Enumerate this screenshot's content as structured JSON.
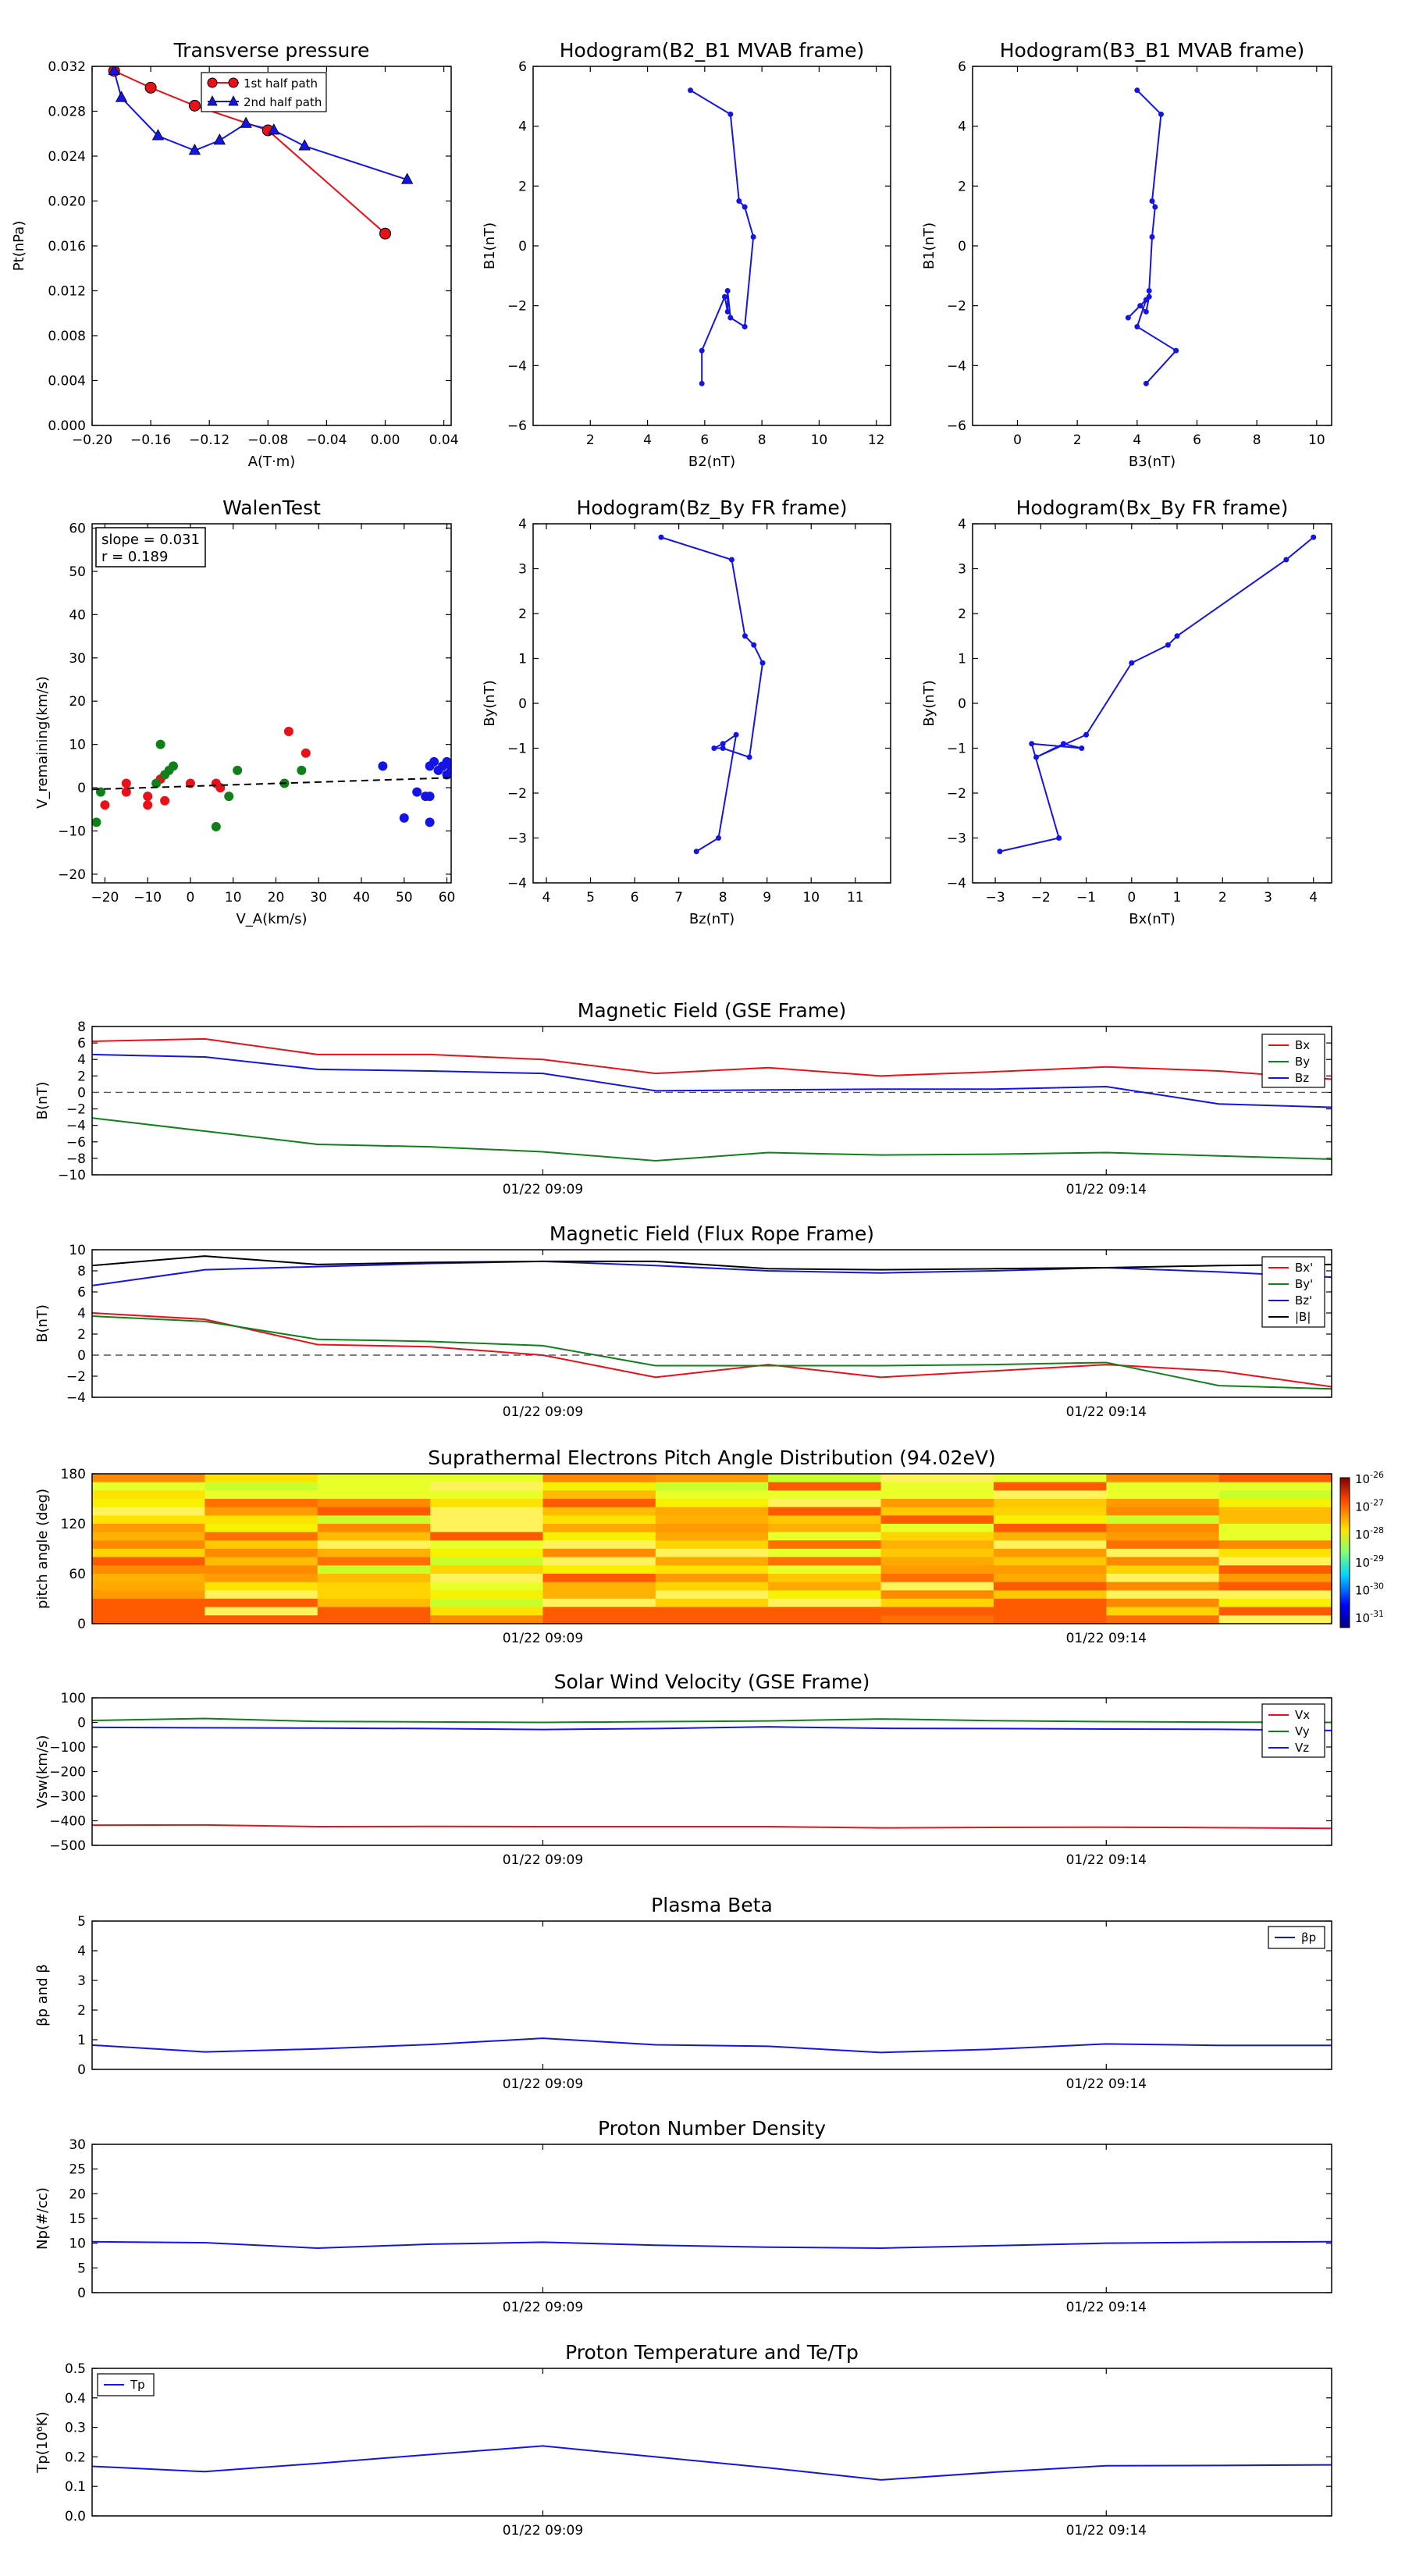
{
  "colors": {
    "red": "#e8111a",
    "green": "#11801a",
    "blue": "#1414e6",
    "black": "#000000"
  },
  "scatter_panels": [
    {
      "key": "tp",
      "title": "Transverse pressure",
      "xlabel": "A(T·m)",
      "ylabel": "Pt(nPa)",
      "xlim": [
        -0.2,
        0.045
      ],
      "ylim": [
        0,
        0.032
      ],
      "xticks": [
        -0.2,
        -0.16,
        -0.12,
        -0.08,
        -0.04,
        0.0,
        0.04
      ],
      "xtick_labels": [
        "−0.20",
        "−0.16",
        "−0.12",
        "−0.08",
        "−0.04",
        "0.00",
        "0.04"
      ],
      "yticks": [
        0,
        0.004,
        0.008,
        0.012,
        0.016,
        0.02,
        0.024,
        0.028,
        0.032
      ],
      "ytick_labels": [
        "0.000",
        "0.004",
        "0.008",
        "0.012",
        "0.016",
        "0.020",
        "0.024",
        "0.028",
        "0.032"
      ],
      "legend": [
        "1st half path",
        "2nd half path"
      ]
    },
    {
      "key": "h1",
      "title": "Hodogram(B2_B1 MVAB frame)",
      "xlabel": "B2(nT)",
      "ylabel": "B1(nT)",
      "xlim": [
        0,
        12.5
      ],
      "ylim": [
        -6,
        6
      ],
      "xticks": [
        2,
        4,
        6,
        8,
        10,
        12
      ],
      "xtick_labels": [
        "2",
        "4",
        "6",
        "8",
        "10",
        "12"
      ],
      "yticks": [
        -6,
        -4,
        -2,
        0,
        2,
        4,
        6
      ],
      "ytick_labels": [
        "−6",
        "−4",
        "−2",
        "0",
        "2",
        "4",
        "6"
      ]
    },
    {
      "key": "h2",
      "title": "Hodogram(B3_B1 MVAB frame)",
      "xlabel": "B3(nT)",
      "ylabel": "B1(nT)",
      "xlim": [
        -1.5,
        10.5
      ],
      "ylim": [
        -6,
        6
      ],
      "xticks": [
        0,
        2,
        4,
        6,
        8,
        10
      ],
      "xtick_labels": [
        "0",
        "2",
        "4",
        "6",
        "8",
        "10"
      ],
      "yticks": [
        -6,
        -4,
        -2,
        0,
        2,
        4,
        6
      ],
      "ytick_labels": [
        "−6",
        "−4",
        "−2",
        "0",
        "2",
        "4",
        "6"
      ]
    },
    {
      "key": "wt",
      "title": "WalenTest",
      "xlabel": "V_A(km/s)",
      "ylabel": "V_remaining(km/s)",
      "xlim": [
        -23,
        61
      ],
      "ylim": [
        -22,
        61
      ],
      "xticks": [
        -20,
        -10,
        0,
        10,
        20,
        30,
        40,
        50,
        60
      ],
      "xtick_labels": [
        "−20",
        "−10",
        "0",
        "10",
        "20",
        "30",
        "40",
        "50",
        "60"
      ],
      "yticks": [
        -20,
        -10,
        0,
        10,
        20,
        30,
        40,
        50,
        60
      ],
      "ytick_labels": [
        "−20",
        "−10",
        "0",
        "10",
        "20",
        "30",
        "40",
        "50",
        "60"
      ],
      "annotation": [
        "slope = 0.031",
        "r = 0.189"
      ]
    },
    {
      "key": "h3",
      "title": "Hodogram(Bz_By FR frame)",
      "xlabel": "Bz(nT)",
      "ylabel": "By(nT)",
      "xlim": [
        3.7,
        11.8
      ],
      "ylim": [
        -4,
        4
      ],
      "xticks": [
        4,
        5,
        6,
        7,
        8,
        9,
        10,
        11
      ],
      "xtick_labels": [
        "4",
        "5",
        "6",
        "7",
        "8",
        "9",
        "10",
        "11"
      ],
      "yticks": [
        -4,
        -3,
        -2,
        -1,
        0,
        1,
        2,
        3,
        4
      ],
      "ytick_labels": [
        "−4",
        "−3",
        "−2",
        "−1",
        "0",
        "1",
        "2",
        "3",
        "4"
      ]
    },
    {
      "key": "h4",
      "title": "Hodogram(Bx_By FR frame)",
      "xlabel": "Bx(nT)",
      "ylabel": "By(nT)",
      "xlim": [
        -3.5,
        4.4
      ],
      "ylim": [
        -4,
        4
      ],
      "xticks": [
        -3,
        -2,
        -1,
        0,
        1,
        2,
        3,
        4
      ],
      "xtick_labels": [
        "−3",
        "−2",
        "−1",
        "0",
        "1",
        "2",
        "3",
        "4"
      ],
      "yticks": [
        -4,
        -3,
        -2,
        -1,
        0,
        1,
        2,
        3,
        4
      ],
      "ytick_labels": [
        "−4",
        "−3",
        "−2",
        "−1",
        "0",
        "1",
        "2",
        "3",
        "4"
      ]
    }
  ],
  "time_axis": {
    "tick_labels": [
      "01/22 09:09",
      "01/22 09:14"
    ],
    "tick_positions": [
      4,
      9
    ],
    "xlim": [
      0,
      11
    ]
  },
  "ts_panels": [
    {
      "key": "mag_gse",
      "title": "Magnetic Field (GSE Frame)",
      "ylabel": "B(nT)",
      "ylim": [
        -10,
        8
      ],
      "yticks": [
        -10,
        -8,
        -6,
        -4,
        -2,
        0,
        2,
        4,
        6,
        8
      ],
      "ytick_labels": [
        "−10",
        "−8",
        "−6",
        "−4",
        "−2",
        "0",
        "2",
        "4",
        "6",
        "8"
      ],
      "zero_line": true,
      "legend": [
        "Bx",
        "By",
        "Bz"
      ]
    },
    {
      "key": "mag_fr",
      "title": "Magnetic Field (Flux Rope Frame)",
      "ylabel": "B(nT)",
      "ylim": [
        -4,
        10
      ],
      "yticks": [
        -4,
        -2,
        0,
        2,
        4,
        6,
        8,
        10
      ],
      "ytick_labels": [
        "−4",
        "−2",
        "0",
        "2",
        "4",
        "6",
        "8",
        "10"
      ],
      "zero_line": true,
      "legend": [
        "Bx'",
        "By'",
        "Bz'",
        "|B|"
      ]
    },
    {
      "key": "pad",
      "title": "Suprathermal Electrons Pitch Angle Distribution (94.02eV)",
      "ylabel": "pitch angle (deg)",
      "ylim": [
        0,
        180
      ],
      "yticks": [
        0,
        60,
        120,
        180
      ],
      "ytick_labels": [
        "0",
        "60",
        "120",
        "180"
      ],
      "colorbar_labels": [
        "10",
        "10",
        "10",
        "10",
        "10",
        "10"
      ],
      "colorbar_exponents": [
        "-26",
        "-27",
        "-28",
        "-29",
        "-30",
        "-31"
      ]
    },
    {
      "key": "vsw",
      "title": "Solar Wind Velocity (GSE Frame)",
      "ylabel": "Vsw(km/s)",
      "ylim": [
        -500,
        100
      ],
      "yticks": [
        -500,
        -400,
        -300,
        -200,
        -100,
        0,
        100
      ],
      "ytick_labels": [
        "−500",
        "−400",
        "−300",
        "−200",
        "−100",
        "0",
        "100"
      ],
      "legend": [
        "Vx",
        "Vy",
        "Vz"
      ]
    },
    {
      "key": "beta",
      "title": "Plasma Beta",
      "ylabel": "βp and β",
      "ylim": [
        0,
        5
      ],
      "yticks": [
        0,
        1,
        2,
        3,
        4,
        5
      ],
      "ytick_labels": [
        "0",
        "1",
        "2",
        "3",
        "4",
        "5"
      ],
      "legend": [
        "βp"
      ]
    },
    {
      "key": "np",
      "title": "Proton Number Density",
      "ylabel": "Np(#/cc)",
      "ylim": [
        0,
        30
      ],
      "yticks": [
        0,
        5,
        10,
        15,
        20,
        25,
        30
      ],
      "ytick_labels": [
        "0",
        "5",
        "10",
        "15",
        "20",
        "25",
        "30"
      ]
    },
    {
      "key": "tp_ts",
      "title": "Proton Temperature and Te/Tp",
      "ylabel": "Tp(10⁶K)",
      "ylim": [
        0,
        0.5
      ],
      "yticks": [
        0,
        0.1,
        0.2,
        0.3,
        0.4,
        0.5
      ],
      "ytick_labels": [
        "0.0",
        "0.1",
        "0.2",
        "0.3",
        "0.4",
        "0.5"
      ],
      "legend": [
        "Tp"
      ]
    }
  ],
  "chart_data": [
    {
      "type": "line",
      "title": "Transverse pressure",
      "xlabel": "A(T·m)",
      "ylabel": "Pt(nPa)",
      "series": [
        {
          "name": "1st half path",
          "x": [
            -0.185,
            -0.16,
            -0.13,
            -0.08,
            0.0
          ],
          "y": [
            0.0316,
            0.0301,
            0.0285,
            0.0263,
            0.0171
          ]
        },
        {
          "name": "2nd half path",
          "x": [
            -0.185,
            -0.18,
            -0.155,
            -0.13,
            -0.113,
            -0.095,
            -0.076,
            -0.055,
            0.015
          ],
          "y": [
            0.0316,
            0.0292,
            0.0258,
            0.0245,
            0.0254,
            0.0269,
            0.0263,
            0.0249,
            0.0219
          ]
        }
      ]
    },
    {
      "type": "line",
      "title": "Hodogram(B2_B1 MVAB frame)",
      "xlabel": "B2(nT)",
      "ylabel": "B1(nT)",
      "series": [
        {
          "x": [
            5.5,
            6.9,
            7.2,
            7.4,
            7.7,
            7.4,
            6.9,
            6.8,
            6.8,
            6.7,
            5.9,
            5.9
          ],
          "y": [
            5.2,
            4.4,
            1.5,
            1.3,
            0.3,
            -2.7,
            -2.4,
            -1.5,
            -2.2,
            -1.7,
            -3.5,
            -4.6
          ]
        }
      ]
    },
    {
      "type": "line",
      "title": "Hodogram(B3_B1 MVAB frame)",
      "xlabel": "B3(nT)",
      "ylabel": "B1(nT)",
      "series": [
        {
          "x": [
            4.0,
            4.8,
            4.5,
            4.6,
            4.5,
            4.4,
            4.4,
            4.3,
            4.1,
            3.7,
            4.3,
            4.0,
            5.3,
            4.3
          ],
          "y": [
            5.2,
            4.4,
            1.5,
            1.3,
            0.3,
            -1.5,
            -1.7,
            -2.2,
            -2.0,
            -2.4,
            -1.8,
            -2.7,
            -3.5,
            -4.6
          ]
        }
      ]
    },
    {
      "type": "scatter",
      "title": "WalenTest",
      "xlabel": "V_A(km/s)",
      "ylabel": "V_remaining(km/s)",
      "annotation": [
        "slope = 0.031",
        "r = 0.189"
      ],
      "series": [
        {
          "x": [
            -20,
            -15,
            -15,
            -10,
            -10,
            -7,
            -6,
            0,
            6,
            7,
            23,
            27
          ],
          "y": [
            -4,
            -1,
            1,
            -2,
            -4,
            2,
            -3,
            1,
            1,
            0,
            13,
            8
          ]
        },
        {
          "x": [
            -22,
            -21,
            -8,
            -7,
            -6,
            -5,
            -4,
            6,
            9,
            11,
            22,
            26
          ],
          "y": [
            -8,
            -1,
            1,
            10,
            3,
            4,
            5,
            -9,
            -2,
            4,
            1,
            4
          ]
        },
        {
          "x": [
            45,
            50,
            53,
            55,
            56,
            56,
            56,
            57,
            58,
            59,
            60,
            61,
            61,
            60
          ],
          "y": [
            5,
            -7,
            -1,
            -2,
            -8,
            -2,
            5,
            6,
            4,
            5,
            3,
            4,
            5,
            6
          ]
        }
      ],
      "fit": {
        "x": [
          -23,
          61
        ],
        "y": [
          -0.4,
          2.3
        ]
      }
    },
    {
      "type": "line",
      "title": "Hodogram(Bz_By FR frame)",
      "xlabel": "Bz(nT)",
      "ylabel": "By(nT)",
      "series": [
        {
          "x": [
            6.6,
            8.2,
            8.5,
            8.7,
            8.9,
            8.6,
            8.0,
            7.8,
            8.0,
            8.3,
            7.9,
            7.4
          ],
          "y": [
            3.7,
            3.2,
            1.5,
            1.3,
            0.9,
            -1.2,
            -1.0,
            -1.0,
            -0.9,
            -0.7,
            -3.0,
            -3.3
          ]
        }
      ]
    },
    {
      "type": "line",
      "title": "Hodogram(Bx_By FR frame)",
      "xlabel": "Bx(nT)",
      "ylabel": "By(nT)",
      "series": [
        {
          "x": [
            4.0,
            3.4,
            1.0,
            0.8,
            0.0,
            -1.0,
            -2.1,
            -1.5,
            -1.1,
            -2.2,
            -1.6,
            -2.9
          ],
          "y": [
            3.7,
            3.2,
            1.5,
            1.3,
            0.9,
            -0.7,
            -1.2,
            -0.9,
            -1.0,
            -0.9,
            -3.0,
            -3.3
          ]
        }
      ]
    },
    {
      "type": "line",
      "title": "Magnetic Field (GSE Frame)",
      "ylabel": "B(nT)",
      "x": [
        0,
        1,
        2,
        3,
        4,
        5,
        6,
        7,
        8,
        9,
        10,
        11
      ],
      "series": [
        {
          "name": "Bx",
          "values": [
            6.2,
            6.5,
            4.6,
            4.6,
            4.0,
            2.3,
            3.0,
            2.0,
            2.5,
            3.1,
            2.6,
            1.6
          ]
        },
        {
          "name": "By",
          "values": [
            -3.1,
            -4.7,
            -6.3,
            -6.6,
            -7.2,
            -8.3,
            -7.3,
            -7.6,
            -7.5,
            -7.3,
            -7.7,
            -8.1
          ]
        },
        {
          "name": "Bz",
          "values": [
            4.6,
            4.3,
            2.8,
            2.6,
            2.3,
            0.2,
            0.3,
            0.4,
            0.4,
            0.7,
            -1.4,
            -1.8
          ]
        }
      ]
    },
    {
      "type": "line",
      "title": "Magnetic Field (Flux Rope Frame)",
      "ylabel": "B(nT)",
      "x": [
        0,
        1,
        2,
        3,
        4,
        5,
        6,
        7,
        8,
        9,
        10,
        11
      ],
      "series": [
        {
          "name": "Bx'",
          "values": [
            4.0,
            3.4,
            1.0,
            0.8,
            0.0,
            -2.1,
            -0.9,
            -2.1,
            -1.5,
            -0.9,
            -1.5,
            -3.0
          ]
        },
        {
          "name": "By'",
          "values": [
            3.7,
            3.2,
            1.5,
            1.3,
            0.9,
            -1.0,
            -1.0,
            -1.0,
            -0.9,
            -0.7,
            -2.9,
            -3.2
          ]
        },
        {
          "name": "Bz'",
          "values": [
            6.6,
            8.1,
            8.4,
            8.7,
            8.9,
            8.5,
            8.0,
            7.8,
            8.0,
            8.3,
            7.9,
            7.4
          ]
        },
        {
          "name": "|B|",
          "values": [
            8.5,
            9.4,
            8.6,
            8.8,
            8.9,
            8.9,
            8.2,
            8.1,
            8.2,
            8.3,
            8.5,
            8.6
          ]
        }
      ]
    },
    {
      "type": "heatmap",
      "title": "Suprathermal Electrons Pitch Angle Distribution (94.02eV)",
      "ylabel": "pitch angle (deg)",
      "x_bins": 11,
      "y_bins": 18,
      "colorbar": [
        "1e-31",
        "1e-26"
      ]
    },
    {
      "type": "line",
      "title": "Solar Wind Velocity (GSE Frame)",
      "ylabel": "Vsw(km/s)",
      "x": [
        0,
        1,
        2,
        3,
        4,
        5,
        6,
        7,
        8,
        9,
        10,
        11
      ],
      "series": [
        {
          "name": "Vx",
          "values": [
            -418,
            -417,
            -424,
            -423,
            -424,
            -424,
            -424,
            -429,
            -427,
            -426,
            -428,
            -431
          ]
        },
        {
          "name": "Vy",
          "values": [
            8,
            16,
            4,
            2,
            0,
            3,
            6,
            14,
            7,
            3,
            1,
            0
          ]
        },
        {
          "name": "Vz",
          "values": [
            -20,
            -22,
            -23,
            -25,
            -29,
            -25,
            -18,
            -24,
            -25,
            -27,
            -28,
            -33
          ]
        }
      ]
    },
    {
      "type": "line",
      "title": "Plasma Beta",
      "ylabel": "βp and β",
      "x": [
        0,
        1,
        2,
        3,
        4,
        5,
        6,
        7,
        8,
        9,
        10,
        11
      ],
      "series": [
        {
          "name": "βp",
          "values": [
            0.82,
            0.59,
            0.69,
            0.84,
            1.05,
            0.83,
            0.78,
            0.57,
            0.68,
            0.86,
            0.81,
            0.81
          ]
        }
      ]
    },
    {
      "type": "line",
      "title": "Proton Number Density",
      "ylabel": "Np(#/cc)",
      "x": [
        0,
        1,
        2,
        3,
        4,
        5,
        6,
        7,
        8,
        9,
        10,
        11
      ],
      "series": [
        {
          "values": [
            10.3,
            10.1,
            9.0,
            9.8,
            10.2,
            9.6,
            9.2,
            9.0,
            9.5,
            10.0,
            10.2,
            10.3
          ]
        }
      ]
    },
    {
      "type": "line",
      "title": "Proton Temperature and Te/Tp",
      "ylabel": "Tp(10⁶K)",
      "x": [
        0,
        1,
        2,
        3,
        4,
        5,
        6,
        7,
        8,
        9,
        10,
        11
      ],
      "series": [
        {
          "name": "Tp",
          "values": [
            0.168,
            0.15,
            0.178,
            0.208,
            0.237,
            0.2,
            0.163,
            0.122,
            0.148,
            0.17,
            0.171,
            0.173
          ]
        }
      ]
    }
  ]
}
